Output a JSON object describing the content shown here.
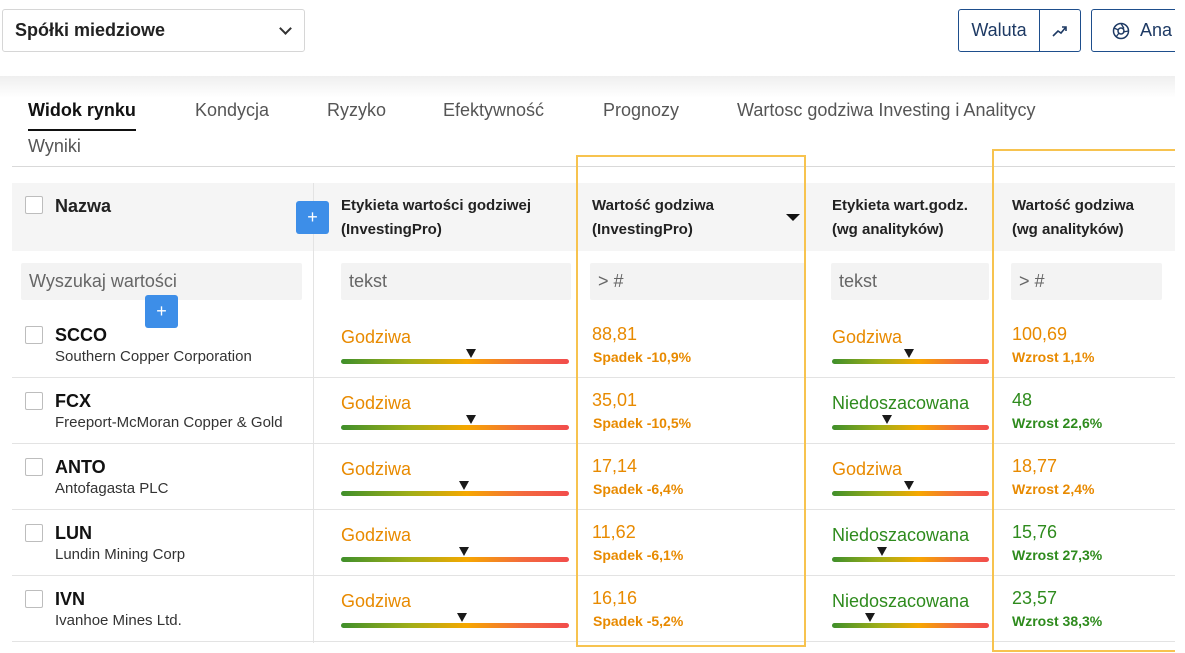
{
  "toolbar": {
    "watchlist": "Spółki miedziowe",
    "currency_button": "Waluta",
    "analyze_button": "Ana"
  },
  "tabs": [
    {
      "label": "Widok rynku",
      "active": true
    },
    {
      "label": "Kondycja"
    },
    {
      "label": "Ryzyko"
    },
    {
      "label": "Efektywność"
    },
    {
      "label": "Prognozy"
    },
    {
      "label": "Wartosc godziwa Investing i Analitycy"
    },
    {
      "label": "Wyniki"
    }
  ],
  "columns": {
    "name": "Nazwa",
    "fv_label_pro_line1": "Etykieta wartości godziwej",
    "fv_label_pro_line2": "(InvestingPro)",
    "fv_pro_line1": "Wartość godziwa",
    "fv_pro_line2": "(InvestingPro)",
    "fv_label_an_line1": "Etykieta wart.godz.",
    "fv_label_an_line2": "(wg analityków)",
    "fv_an_line1": "Wartość godziwa",
    "fv_an_line2": "(wg analityków)"
  },
  "filters": {
    "name_placeholder": "Wyszukaj wartości",
    "text_placeholder": "tekst",
    "number_placeholder": "> #"
  },
  "rows": [
    {
      "ticker": "SCCO",
      "company": "Southern Copper Corporation",
      "pro_label": "Godziwa",
      "pro_marker": 0.57,
      "pro_value": "88,81",
      "pro_change": "Spadek -10,9%",
      "an_label": "Godziwa",
      "an_marker": 0.49,
      "an_value": "100,69",
      "an_change": "Wzrost 1,1%",
      "an_label_color": "orange",
      "an_value_color": "orange"
    },
    {
      "ticker": "FCX",
      "company": "Freeport-McMoran Copper & Gold",
      "pro_label": "Godziwa",
      "pro_marker": 0.57,
      "pro_value": "35,01",
      "pro_change": "Spadek -10,5%",
      "an_label": "Niedoszacowana",
      "an_marker": 0.35,
      "an_value": "48",
      "an_change": "Wzrost 22,6%",
      "an_label_color": "green",
      "an_value_color": "green"
    },
    {
      "ticker": "ANTO",
      "company": "Antofagasta PLC",
      "pro_label": "Godziwa",
      "pro_marker": 0.54,
      "pro_value": "17,14",
      "pro_change": "Spadek -6,4%",
      "an_label": "Godziwa",
      "an_marker": 0.49,
      "an_value": "18,77",
      "an_change": "Wzrost 2,4%",
      "an_label_color": "orange",
      "an_value_color": "orange"
    },
    {
      "ticker": "LUN",
      "company": "Lundin Mining Corp",
      "pro_label": "Godziwa",
      "pro_marker": 0.54,
      "pro_value": "11,62",
      "pro_change": "Spadek -6,1%",
      "an_label": "Niedoszacowana",
      "an_marker": 0.32,
      "an_value": "15,76",
      "an_change": "Wzrost 27,3%",
      "an_label_color": "green",
      "an_value_color": "green"
    },
    {
      "ticker": "IVN",
      "company": "Ivanhoe Mines Ltd.",
      "pro_label": "Godziwa",
      "pro_marker": 0.53,
      "pro_value": "16,16",
      "pro_change": "Spadek -5,2%",
      "an_label": "Niedoszacowana",
      "an_marker": 0.24,
      "an_value": "23,57",
      "an_change": "Wzrost 38,3%",
      "an_label_color": "green",
      "an_value_color": "green"
    }
  ],
  "colors": {
    "orange": "#e88a00",
    "green": "#2e8b1d",
    "accent": "#3d8ee8",
    "highlight": "#f7c34f"
  }
}
